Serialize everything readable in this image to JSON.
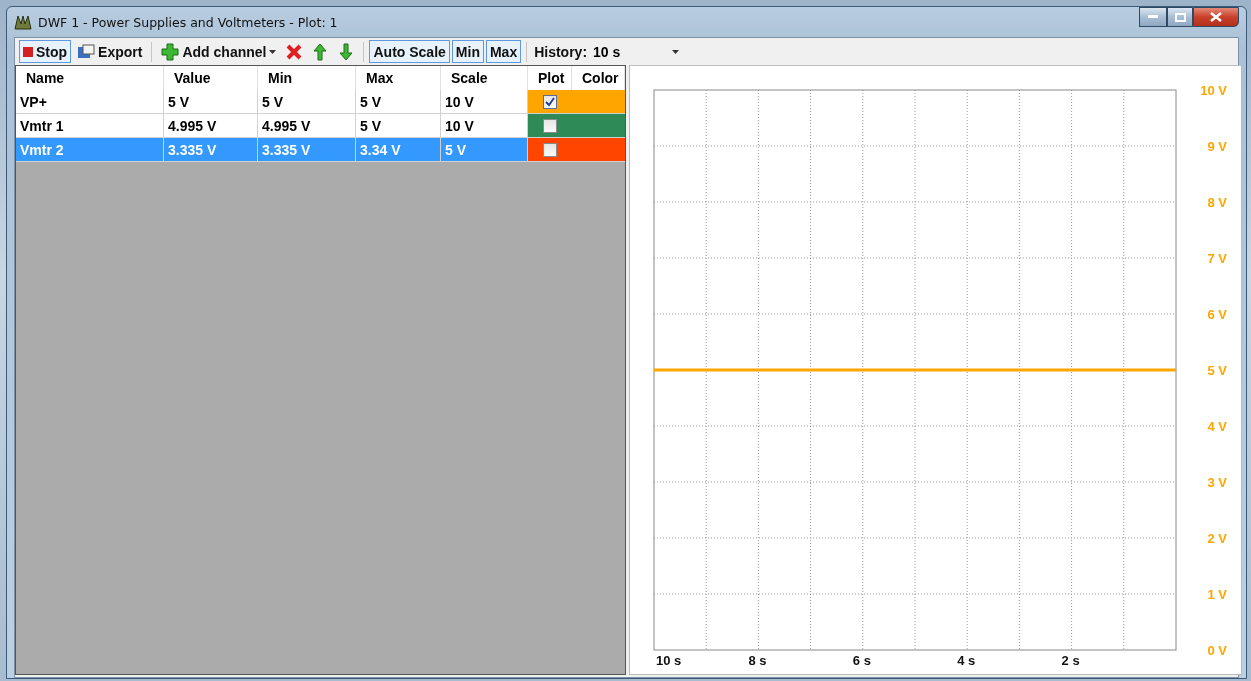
{
  "window": {
    "title": "DWF 1 - Power Supplies and Voltmeters  - Plot: 1"
  },
  "toolbar": {
    "stop": "Stop",
    "export": "Export",
    "add_channel": "Add channel",
    "auto_scale": "Auto Scale",
    "min": "Min",
    "max": "Max",
    "history_label": "History:",
    "history_value": "10 s"
  },
  "table": {
    "columns": [
      "Name",
      "Value",
      "Min",
      "Max",
      "Scale",
      "Plot",
      "Color"
    ],
    "rows": [
      {
        "name": "VP+",
        "value": "5 V",
        "min": "5 V",
        "max": "5 V",
        "scale": "10 V",
        "plot": true,
        "color": "#ffa500",
        "selected": false
      },
      {
        "name": "Vmtr 1",
        "value": "4.995 V",
        "min": "4.995 V",
        "max": "5 V",
        "scale": "10 V",
        "plot": false,
        "color": "#2e8b57",
        "selected": false
      },
      {
        "name": "Vmtr 2",
        "value": "3.335 V",
        "min": "3.335 V",
        "max": "3.34 V",
        "scale": "5 V",
        "plot": false,
        "color": "#ff4500",
        "selected": true
      }
    ]
  },
  "plot": {
    "chart_data": {
      "type": "line",
      "grid": true,
      "x": [
        10,
        0
      ],
      "xlim": [
        10,
        0
      ],
      "ylim": [
        0,
        10
      ],
      "xticks": [
        {
          "value": 10,
          "label": "10 s"
        },
        {
          "value": 8,
          "label": "8 s"
        },
        {
          "value": 6,
          "label": "6 s"
        },
        {
          "value": 4,
          "label": "4 s"
        },
        {
          "value": 2,
          "label": "2 s"
        }
      ],
      "yticks": [
        {
          "value": 0,
          "label": "0 V"
        },
        {
          "value": 1,
          "label": "1 V"
        },
        {
          "value": 2,
          "label": "2 V"
        },
        {
          "value": 3,
          "label": "3 V"
        },
        {
          "value": 4,
          "label": "4 V"
        },
        {
          "value": 5,
          "label": "5 V"
        },
        {
          "value": 6,
          "label": "6 V"
        },
        {
          "value": 7,
          "label": "7 V"
        },
        {
          "value": 8,
          "label": "8 V"
        },
        {
          "value": 9,
          "label": "9 V"
        },
        {
          "value": 10,
          "label": "10 V"
        }
      ],
      "series": [
        {
          "color": "#ffa500",
          "values": [
            5,
            5
          ]
        }
      ]
    }
  }
}
